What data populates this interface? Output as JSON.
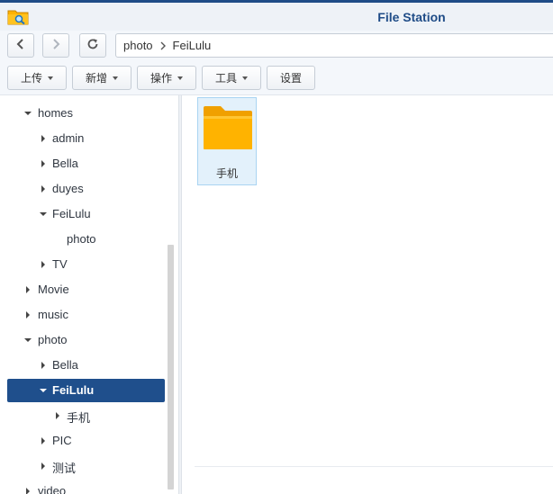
{
  "window": {
    "title": "File Station",
    "app_icon": "file-station-folder-magnifier-icon"
  },
  "navigation": {
    "back_icon": "chevron-left-icon",
    "forward_icon": "chevron-right-icon",
    "refresh_icon": "refresh-icon",
    "path": [
      {
        "label": "photo"
      },
      {
        "label": "FeiLulu"
      }
    ]
  },
  "toolbar": {
    "upload_label": "上传",
    "create_label": "新增",
    "action_label": "操作",
    "tools_label": "工具",
    "settings_label": "设置"
  },
  "tree": {
    "homes": "homes",
    "admin": "admin",
    "bella": "Bella",
    "duyes": "duyes",
    "feilulu": "FeiLulu",
    "feilulu_photo": "photo",
    "tv": "TV",
    "movie": "Movie",
    "music": "music",
    "photo": "photo",
    "photo_bella": "Bella",
    "photo_feilulu": "FeiLulu",
    "phone": "手机",
    "pic": "PIC",
    "test": "测试",
    "video": "video"
  },
  "files": [
    {
      "name": "手机",
      "type": "folder",
      "selected": true
    }
  ],
  "colors": {
    "accent": "#1f4c87",
    "selection": "#1f4f8c",
    "folder": "#ffb300",
    "tile_bg": "#e3f1fb"
  }
}
